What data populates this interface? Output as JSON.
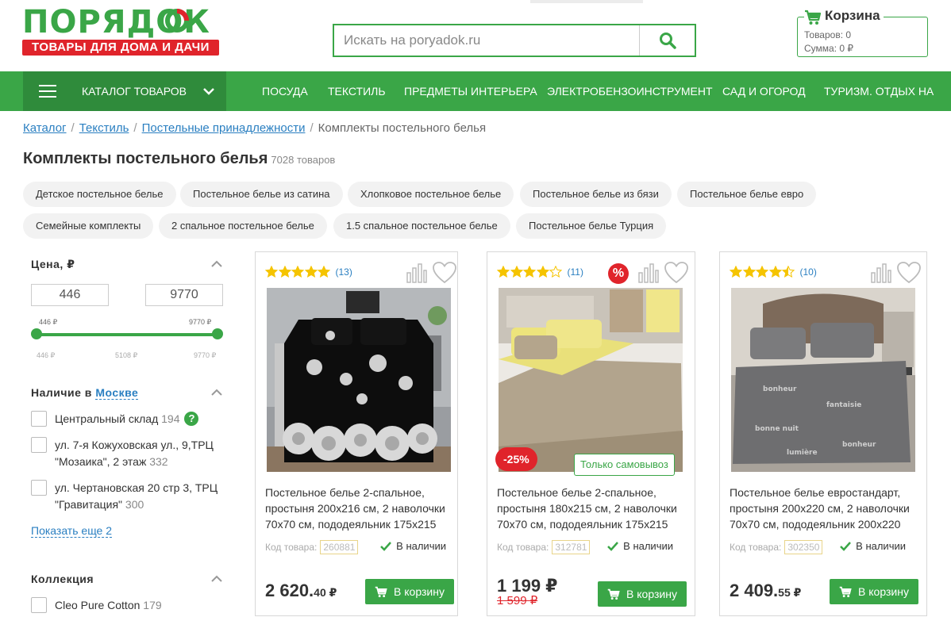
{
  "header": {
    "logo_word": "ПОРЯДОК",
    "logo_tagline": "ТОВАРЫ ДЛЯ ДОМА И ДАЧИ",
    "search_placeholder": "Искать на poryadok.ru",
    "cart": {
      "title": "Корзина",
      "items": "Товаров: 0",
      "sum": "Сумма: 0 ₽"
    }
  },
  "nav": {
    "catalog_label": "КАТАЛОГ ТОВАРОВ",
    "items": [
      "ПОСУДА",
      "ТЕКСТИЛЬ",
      "ПРЕДМЕТЫ ИНТЕРЬЕРА",
      "ЭЛЕКТРОБЕНЗОИНСТРУМЕНТ",
      "САД И ОГОРОД",
      "ТУРИЗМ. ОТДЫХ НА"
    ]
  },
  "breadcrumb": [
    "Каталог",
    "Текстиль",
    "Постельные принадлежности",
    "Комплекты постельного белья"
  ],
  "page": {
    "title": "Комплекты постельного белья",
    "count": "7028 товаров"
  },
  "chips": [
    "Детское постельное белье",
    "Постельное белье из сатина",
    "Хлопковое постельное белье",
    "Постельное белье из бязи",
    "Постельное белье евро",
    "Семейные комплекты",
    "2 спальное постельное белье",
    "1.5 спальное постельное белье",
    "Постельное белье Турция"
  ],
  "filters": {
    "price": {
      "title": "Цена, ₽",
      "min": "446",
      "max": "9770",
      "min_label": "446 ₽",
      "max_label": "9770 ₽",
      "ticks": [
        "446 ₽",
        "5108 ₽",
        "9770 ₽"
      ],
      "selected_from_fraction": 0,
      "selected_to_fraction": 1
    },
    "availability": {
      "title": "Наличие в",
      "city": "Москве",
      "options": [
        {
          "label": "Центральный склад",
          "count": "194",
          "help": "?"
        },
        {
          "label": "ул. 7-я Кожуховская ул., 9,ТРЦ \"Мозаика\", 2 этаж",
          "count": "332"
        },
        {
          "label": "ул. Чертановская 20 стр 3, ТРЦ \"Гравитация\"",
          "count": "300"
        }
      ],
      "show_more": "Показать еще 2"
    },
    "collection": {
      "title": "Коллекция",
      "options": [
        {
          "label": "Cleo Pure Cotton",
          "count": "179"
        }
      ]
    }
  },
  "products": [
    {
      "rating": 5,
      "reviews": "(13)",
      "name": "Постельное белье 2-спальное, простыня 200х216 см, 2 наволочки 70х70 см, пододеяльник 175х215",
      "code_label": "Код товара:",
      "code": "260881",
      "availability": "В наличии",
      "price_main": "2 620.",
      "price_kop": "40 ₽",
      "buy_label": "В корзину"
    },
    {
      "rating": 4,
      "reviews": "(11)",
      "sale_icon": "%",
      "discount": "-25%",
      "pickup": "Только самовывоз",
      "name": "Постельное белье 2-спальное, простыня 180х215 см, 2 наволочки 70х70 см, пододеяльник 175х215",
      "code_label": "Код товара:",
      "code": "312781",
      "availability": "В наличии",
      "price_main": "1 199 ₽",
      "old_price": "1 599 ₽",
      "buy_label": "В корзину"
    },
    {
      "rating": 4.5,
      "reviews": "(10)",
      "name": "Постельное белье евростандарт, простыня 200х220 см, 2 наволочки 70х70 см, пододеяльник 200х220",
      "code_label": "Код товара:",
      "code": "302350",
      "availability": "В наличии",
      "price_main": "2 409.",
      "price_kop": "55 ₽",
      "buy_label": "В корзину"
    }
  ],
  "colors": {
    "brand_green": "#3aa647",
    "dark_green": "#2f8b3b",
    "accent_red": "#e0242b",
    "link_blue": "#2a7fc1",
    "star_yellow": "#f5c400"
  }
}
